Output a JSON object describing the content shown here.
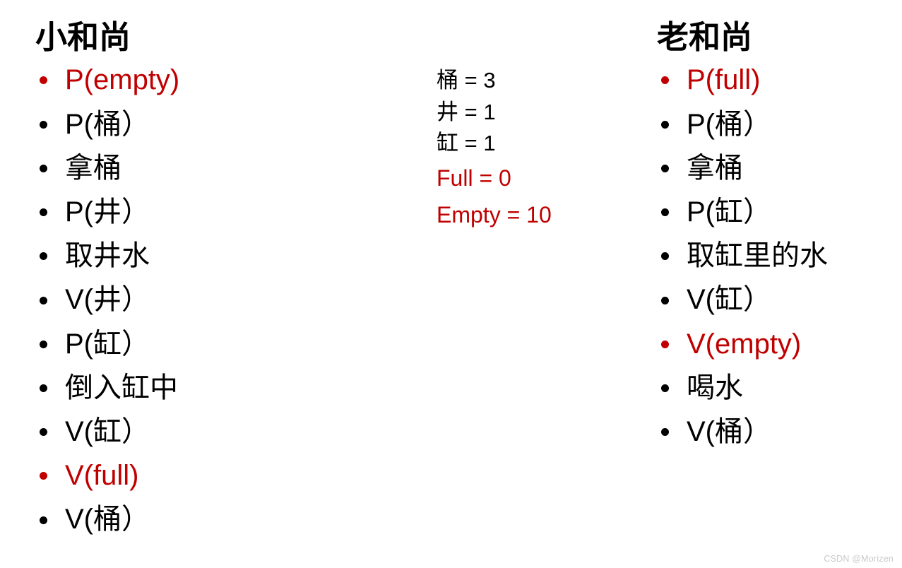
{
  "slide": {
    "background_color": "#ffffff",
    "accent_color": "#C00000",
    "text_color": "#000000"
  },
  "left_column": {
    "title": "小和尚",
    "items": [
      {
        "text": "P(empty)",
        "accent": true
      },
      {
        "text": "P(桶）",
        "accent": false
      },
      {
        "text": "拿桶",
        "accent": false
      },
      {
        "text": "P(井）",
        "accent": false
      },
      {
        "text": "取井水",
        "accent": false
      },
      {
        "text": "V(井）",
        "accent": false
      },
      {
        "text": "P(缸）",
        "accent": false
      },
      {
        "text": "倒入缸中",
        "accent": false
      },
      {
        "text": "V(缸）",
        "accent": false
      },
      {
        "text": "V(full)",
        "accent": true
      },
      {
        "text": "V(桶）",
        "accent": false
      }
    ]
  },
  "middle_column": {
    "items": [
      {
        "text": "桶 = 3",
        "accent": false
      },
      {
        "text": "井 = 1",
        "accent": false
      },
      {
        "text": "缸 = 1",
        "accent": false
      },
      {
        "text": "Full = 0",
        "accent": true
      },
      {
        "text": "Empty = 10",
        "accent": true
      }
    ]
  },
  "right_column": {
    "title": "老和尚",
    "items": [
      {
        "text": "P(full)",
        "accent": true
      },
      {
        "text": "P(桶）",
        "accent": false
      },
      {
        "text": "拿桶",
        "accent": false
      },
      {
        "text": "P(缸）",
        "accent": false
      },
      {
        "text": "取缸里的水",
        "accent": false
      },
      {
        "text": "V(缸）",
        "accent": false
      },
      {
        "text": "V(empty)",
        "accent": true
      },
      {
        "text": "喝水",
        "accent": false
      },
      {
        "text": "V(桶）",
        "accent": false
      }
    ]
  },
  "watermark": {
    "text": "CSDN @Morizen"
  }
}
